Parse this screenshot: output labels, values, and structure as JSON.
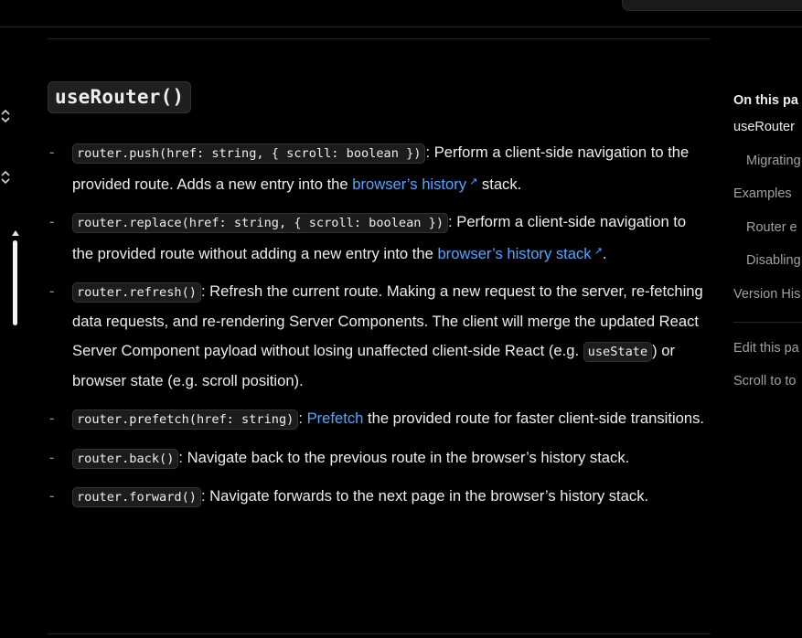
{
  "heading": "useRouter()",
  "items": [
    {
      "code": "router.push(href: string, { scroll: boolean })",
      "text_before_link": ": Perform a client-side navigation to the provided route. Adds a new entry into the ",
      "link": "browser’s history",
      "text_after_link": " stack."
    },
    {
      "code": "router.replace(href: string, { scroll: boolean })",
      "text_before_link": ": Perform a client-side navigation to the provided route without adding a new entry into the ",
      "link": "browser’s history stack",
      "text_after_link": "."
    },
    {
      "code": "router.refresh()",
      "text": ": Refresh the current route. Making a new request to the server, re-fetching data requests, and re-rendering Server Components. The client will merge the updated React Server Component payload without losing unaffected client-side React (e.g. ",
      "inline_code": "useState",
      "text_after": ") or browser state (e.g. scroll position)."
    },
    {
      "code": "router.prefetch(href: string)",
      "sep": ": ",
      "link": "Prefetch",
      "text_after_link": " the provided route for faster client-side transitions."
    },
    {
      "code": "router.back()",
      "text": ": Navigate back to the previous route in the browser’s history stack."
    },
    {
      "code": "router.forward()",
      "text": ": Navigate forwards to the next page in the browser’s history stack."
    }
  ],
  "external_icon": "↗",
  "toc": {
    "title": "On this pa",
    "items": [
      {
        "label": "useRouter",
        "level": 0
      },
      {
        "label": "Migrating",
        "level": 1
      },
      {
        "label": "Examples",
        "level": 0
      },
      {
        "label": "Router e",
        "level": 1
      },
      {
        "label": "Disabling",
        "level": 1
      },
      {
        "label": "Version His",
        "level": 0
      }
    ],
    "actions": [
      "Edit this pa",
      "Scroll to to"
    ]
  },
  "colors": {
    "background": "#000000",
    "text": "#ededed",
    "muted": "#a1a1a1",
    "link": "#52a8ff",
    "code_bg": "#1c1c1c"
  }
}
